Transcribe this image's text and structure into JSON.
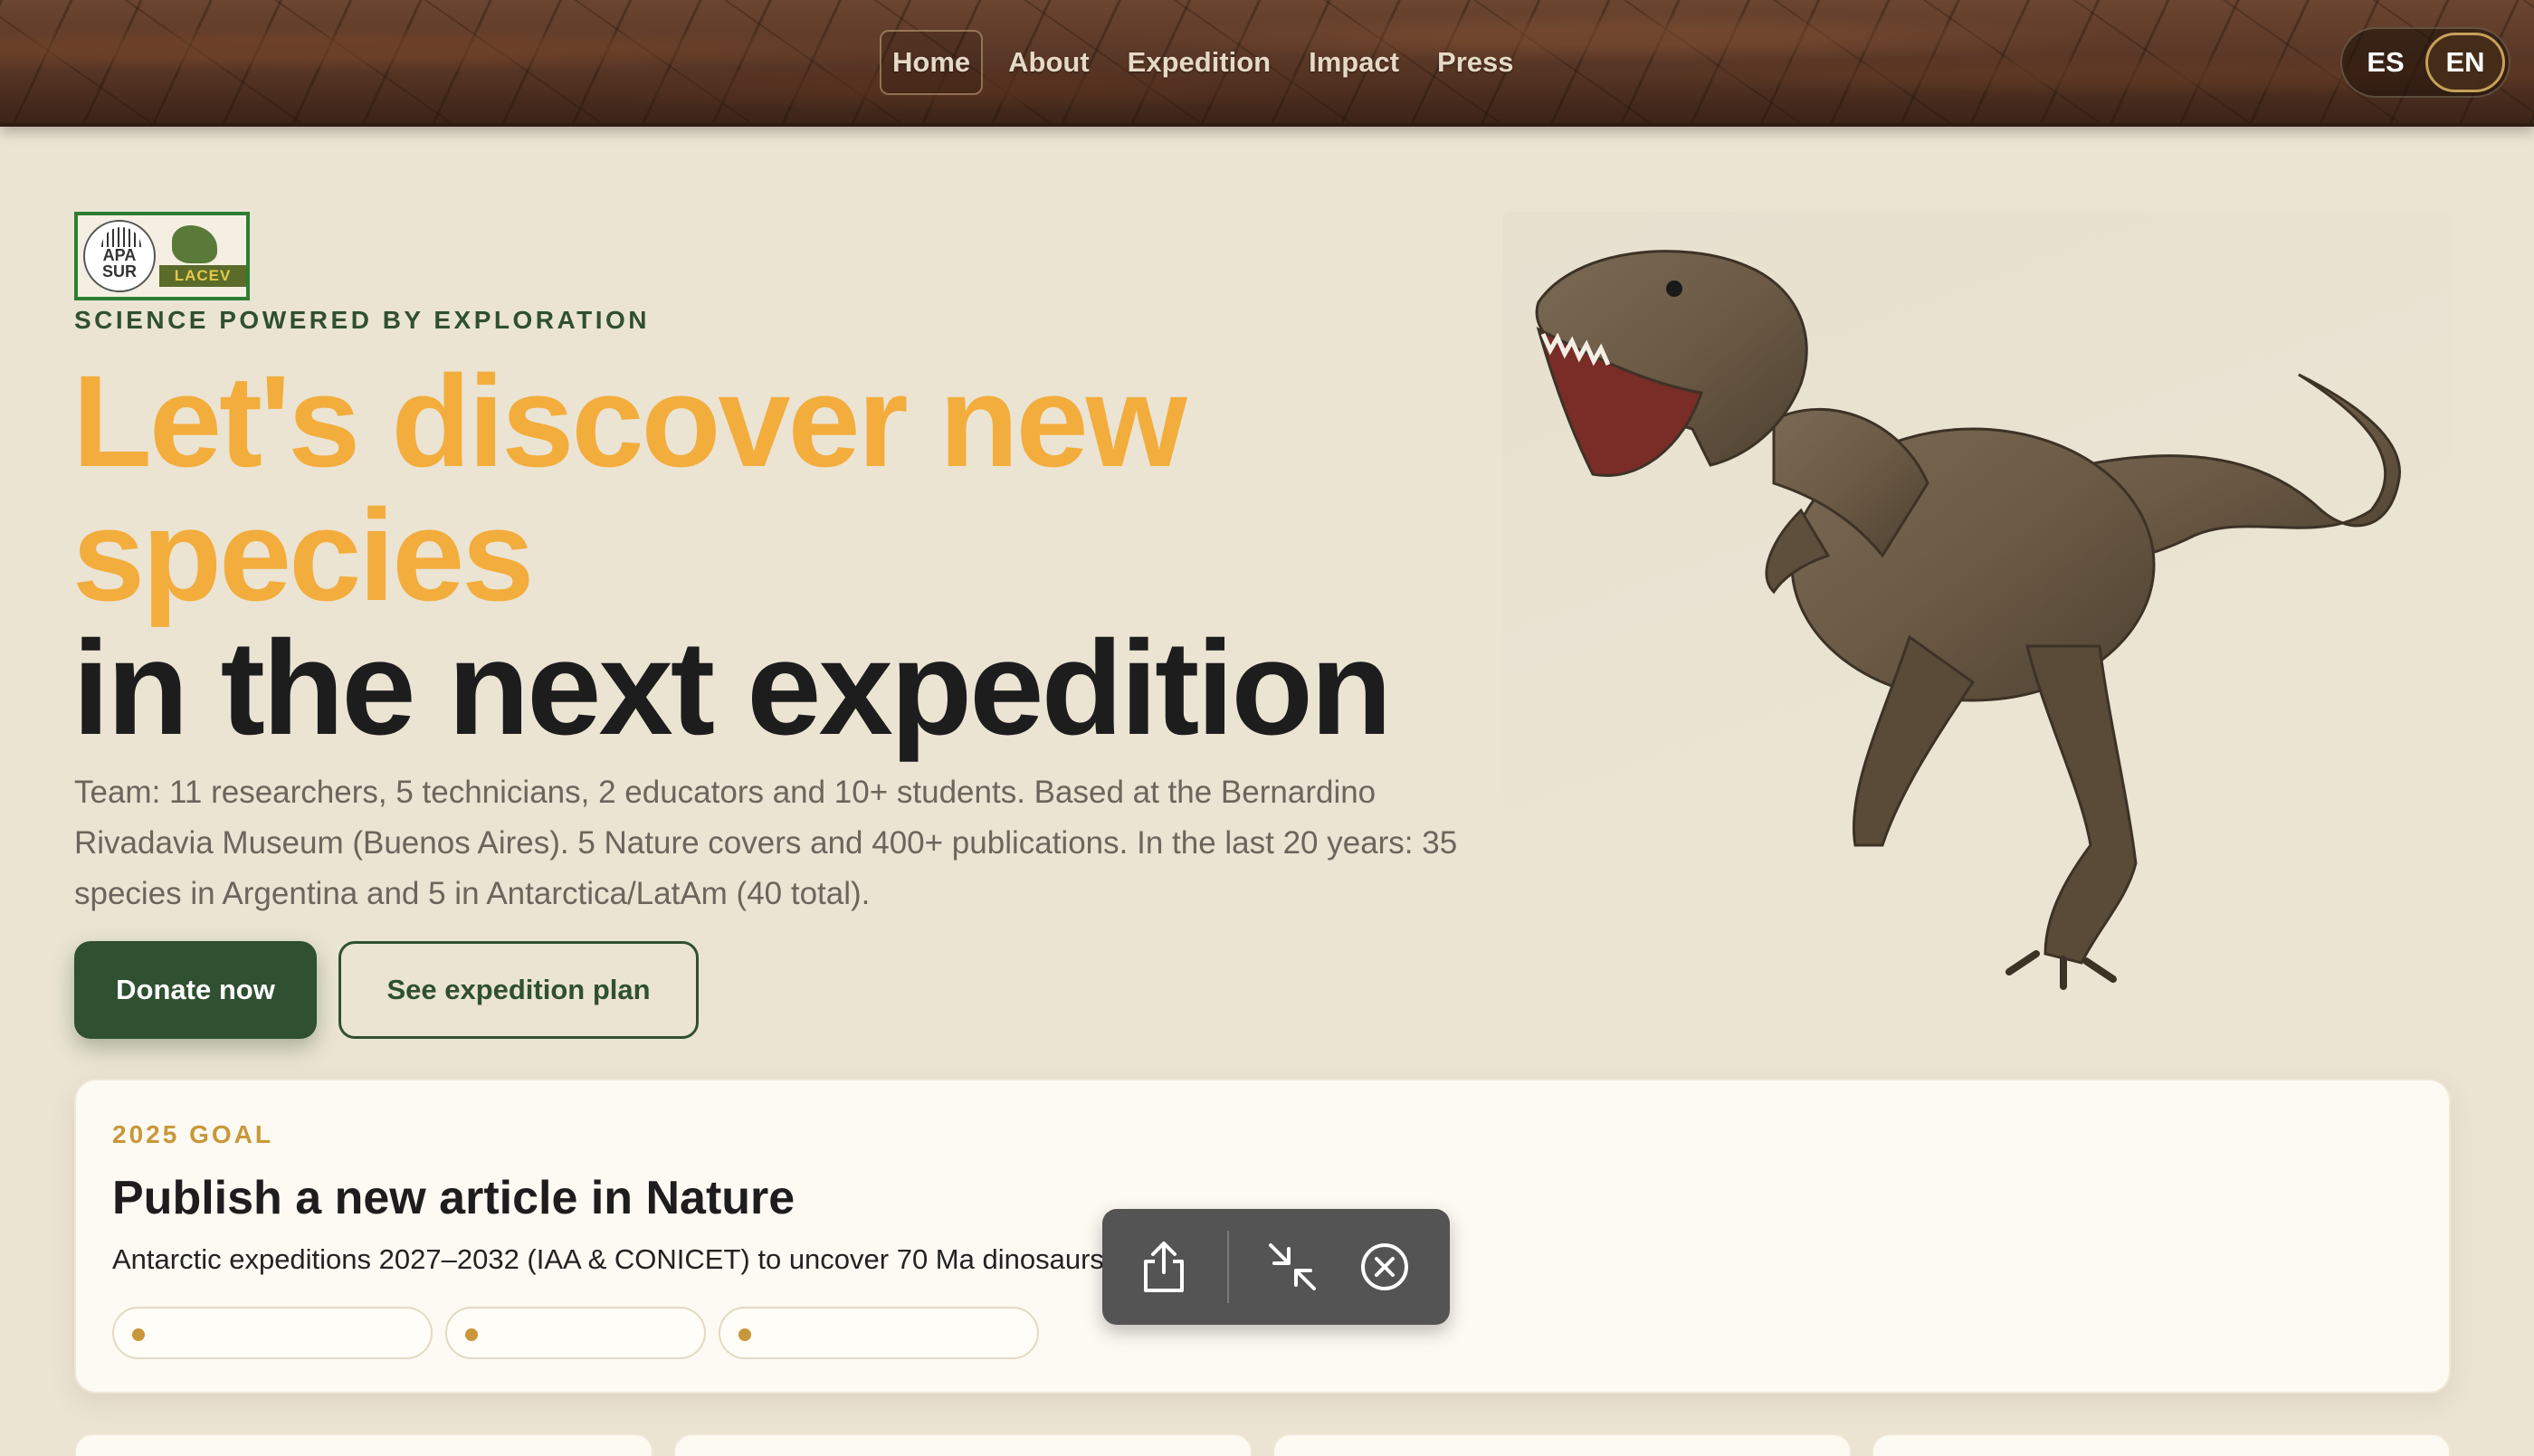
{
  "nav": {
    "items": [
      {
        "label": "Home",
        "active": true
      },
      {
        "label": "About",
        "active": false
      },
      {
        "label": "Expedition",
        "active": false
      },
      {
        "label": "Impact",
        "active": false
      },
      {
        "label": "Press",
        "active": false
      }
    ],
    "languages": {
      "es": "ES",
      "en": "EN",
      "selected": "EN"
    }
  },
  "logo": {
    "apa_line1": "APA",
    "apa_line2": "SUR",
    "lacev": "LACEV"
  },
  "hero": {
    "eyebrow": "SCIENCE POWERED BY EXPLORATION",
    "headline_line1": "Let's discover new",
    "headline_line2": "species",
    "headline_line3": "in the next expedition",
    "lead": "Team: 11 researchers, 5 technicians, 2 educators and 10+ students. Based at the Bernardino Rivadavia Museum (Buenos Aires). 5 Nature covers and 400+ publications. In the last 20 years: 35 species in Argentina and 5 in Antarctica/LatAm (40 total).",
    "primary_button": "Donate now",
    "secondary_button": "See expedition plan"
  },
  "goal": {
    "eyebrow": "2025 GOAL",
    "title": "Publish a new article in Nature",
    "description": "Antarctic expeditions 2027–2032 (IAA & CONICET) to uncover 70 Ma dinosaurs"
  },
  "toolbar": {
    "share_icon": "share-icon",
    "minimize_icon": "minimize-icon",
    "close_icon": "close-icon"
  },
  "colors": {
    "accent_orange": "#f2ad3d",
    "brand_green": "#2f5031",
    "goal_gold": "#c9973a",
    "background": "#ebe4d3"
  }
}
